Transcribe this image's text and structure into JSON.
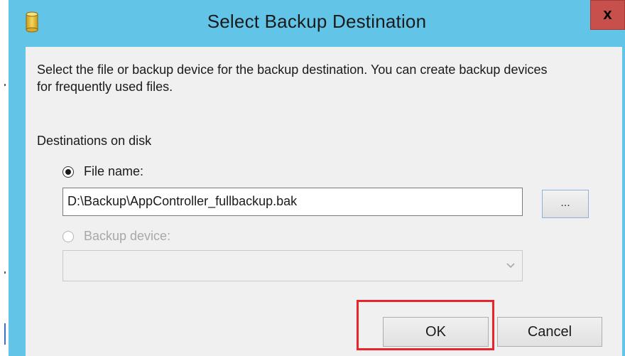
{
  "window": {
    "title": "Select Backup Destination",
    "close_glyph": "x",
    "icon": "database-icon"
  },
  "dialog": {
    "description": "Select the file or backup device for the backup destination. You can create backup devices for frequently used files.",
    "group_label": "Destinations on disk",
    "file_name_option": {
      "label": "File name:",
      "selected": true
    },
    "file_name_value": "D:\\Backup\\AppController_fullbackup.bak",
    "browse_label": "...",
    "backup_device_option": {
      "label": "Backup device:",
      "selected": false,
      "enabled": false
    },
    "backup_device_value": ""
  },
  "buttons": {
    "ok_label": "OK",
    "cancel_label": "Cancel"
  },
  "colors": {
    "titlebar": "#62c5e8",
    "close_button": "#c7504d",
    "client_background": "#f0f0f0",
    "highlight": "#e8242c"
  }
}
